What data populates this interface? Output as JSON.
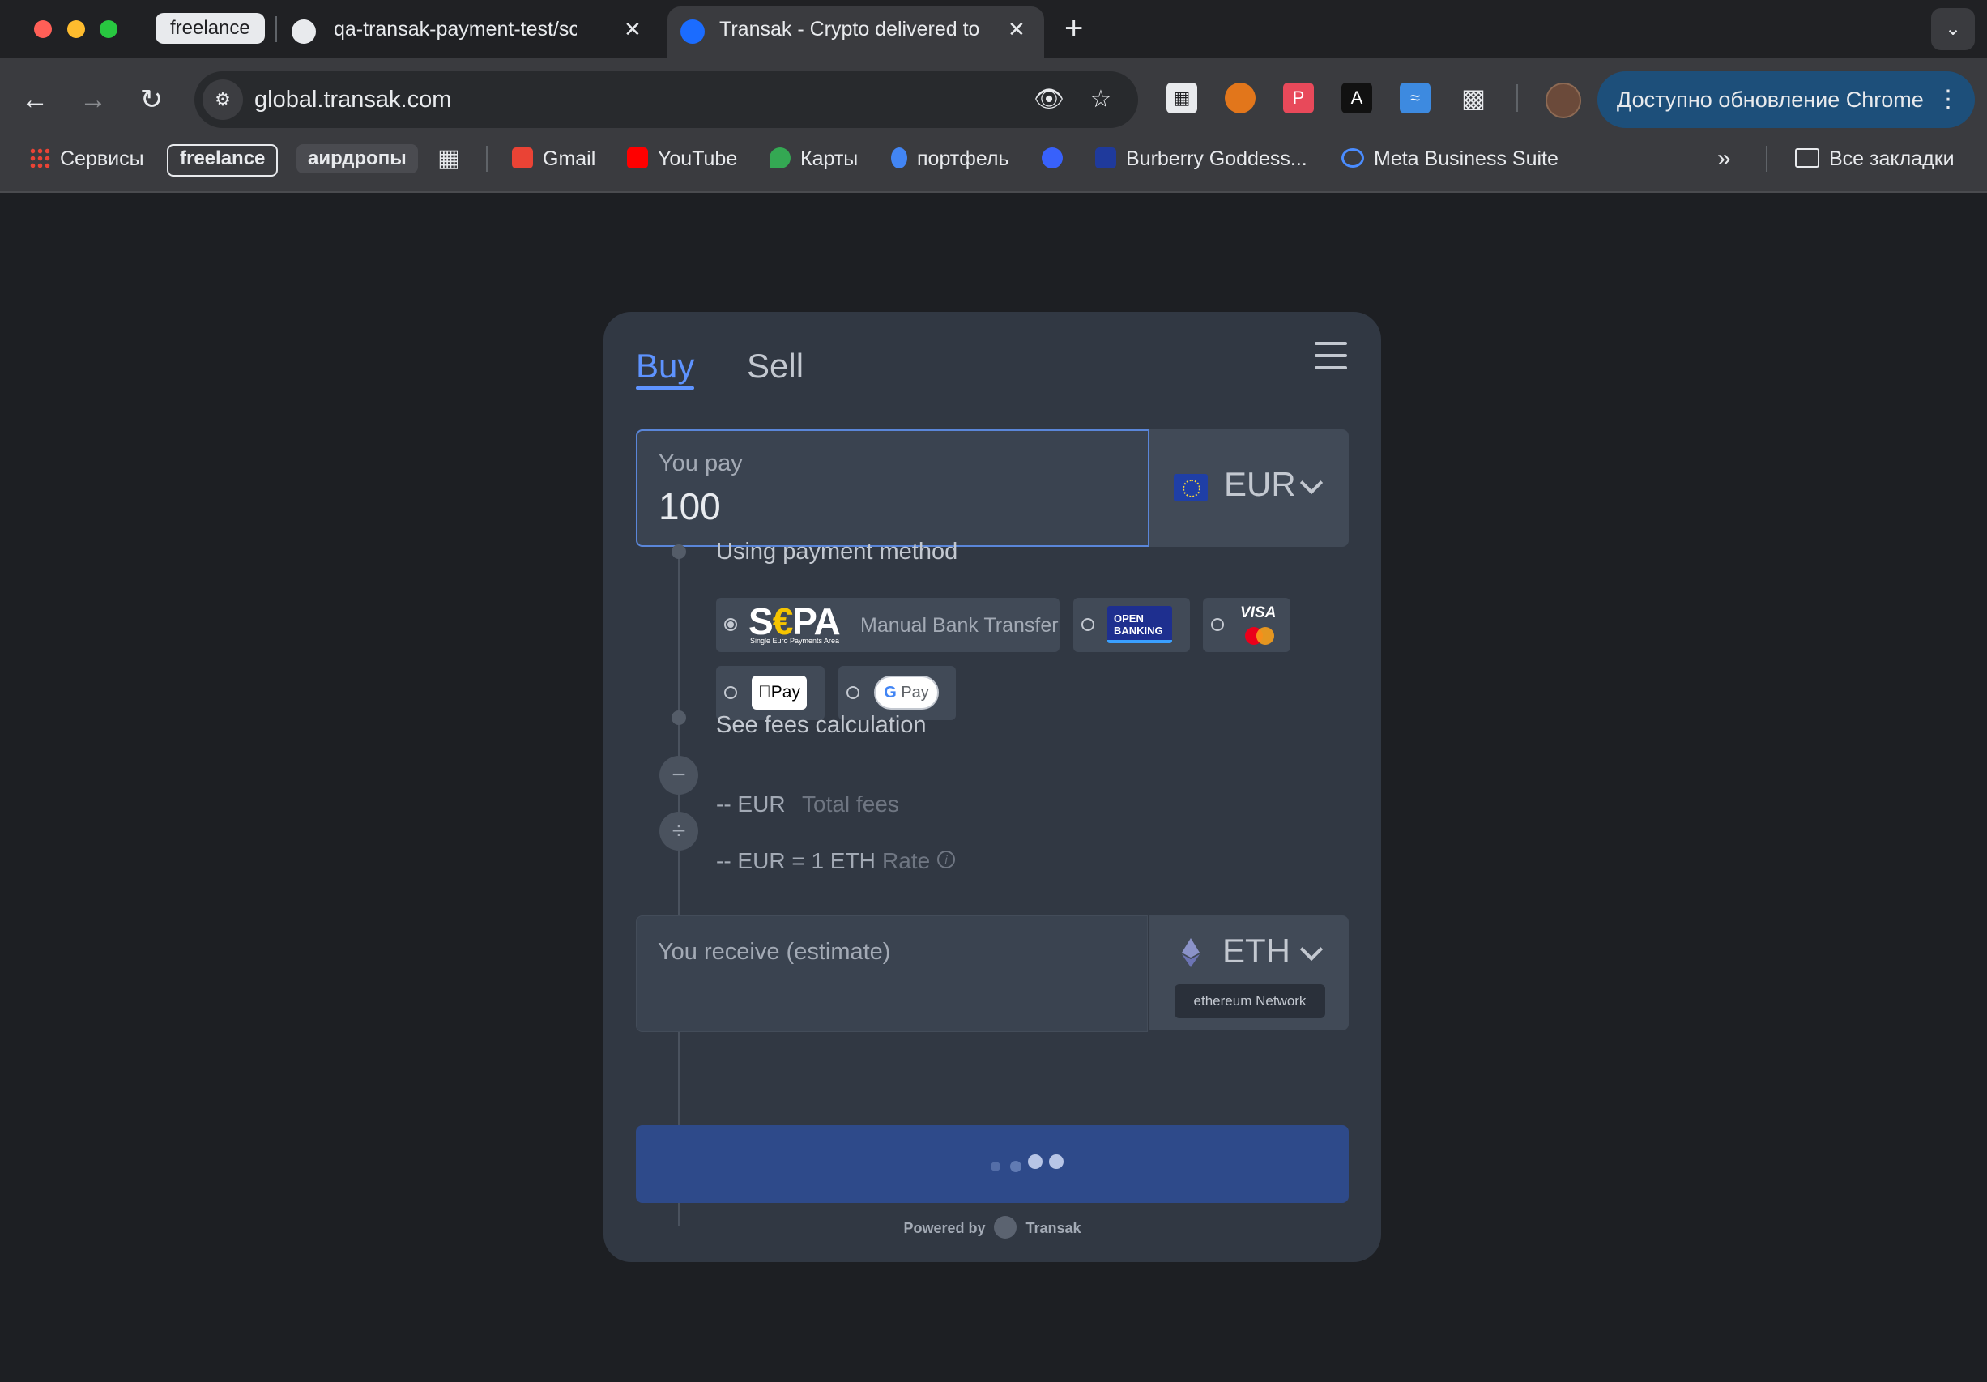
{
  "browser": {
    "tab_group_label": "freelance",
    "tabs": [
      {
        "title": "qa-transak-payment-test/scr",
        "close": "✕"
      },
      {
        "title": "Transak - Crypto delivered to",
        "close": "✕"
      }
    ],
    "new_tab": "+",
    "tab_search": "⌄",
    "url": "global.transak.com",
    "update_button": "Доступно обновление Chrome",
    "bookmarks": {
      "apps": "Сервисы",
      "freelance": "freelance",
      "airdrops": "аирдропы",
      "gmail": "Gmail",
      "youtube": "YouTube",
      "maps": "Карты",
      "portfolio": "портфель",
      "burberry": "Burberry Goddess...",
      "meta": "Meta Business Suite",
      "all": "Все закладки"
    }
  },
  "widget": {
    "tabs": {
      "buy": "Buy",
      "sell": "Sell",
      "active": "buy"
    },
    "pay": {
      "label": "You pay",
      "value": "100",
      "currency": "EUR"
    },
    "payment_method": {
      "label": "Using payment method",
      "options": [
        {
          "id": "sepa",
          "logo_text": "SEPA",
          "logo_sub": "Single Euro Payments Area",
          "label": "Manual Bank Transfer",
          "selected": true
        },
        {
          "id": "open_banking",
          "logo_line1": "OPEN",
          "logo_line2": "BANKING",
          "selected": false
        },
        {
          "id": "card",
          "logo_text": "VISA",
          "selected": false
        },
        {
          "id": "apple_pay",
          "logo_text": "Pay",
          "selected": false
        },
        {
          "id": "google_pay",
          "logo_text": "Pay",
          "selected": false
        }
      ]
    },
    "fees": {
      "see_label": "See fees calculation",
      "total_value": "-- EUR",
      "total_label": "Total fees",
      "rate_value": "-- EUR = 1 ETH",
      "rate_label": "Rate",
      "minus_symbol": "−",
      "divide_symbol": "÷"
    },
    "receive": {
      "label": "You receive (estimate)",
      "currency": "ETH",
      "network": "ethereum Network"
    },
    "cta_state": "loading",
    "powered_by": "Powered by",
    "brand": "Transak"
  },
  "colors": {
    "accent": "#5e93ff",
    "widget_bg": "#313843",
    "cta_bg": "#2e4a8a",
    "page_bg": "#1d1f23"
  }
}
